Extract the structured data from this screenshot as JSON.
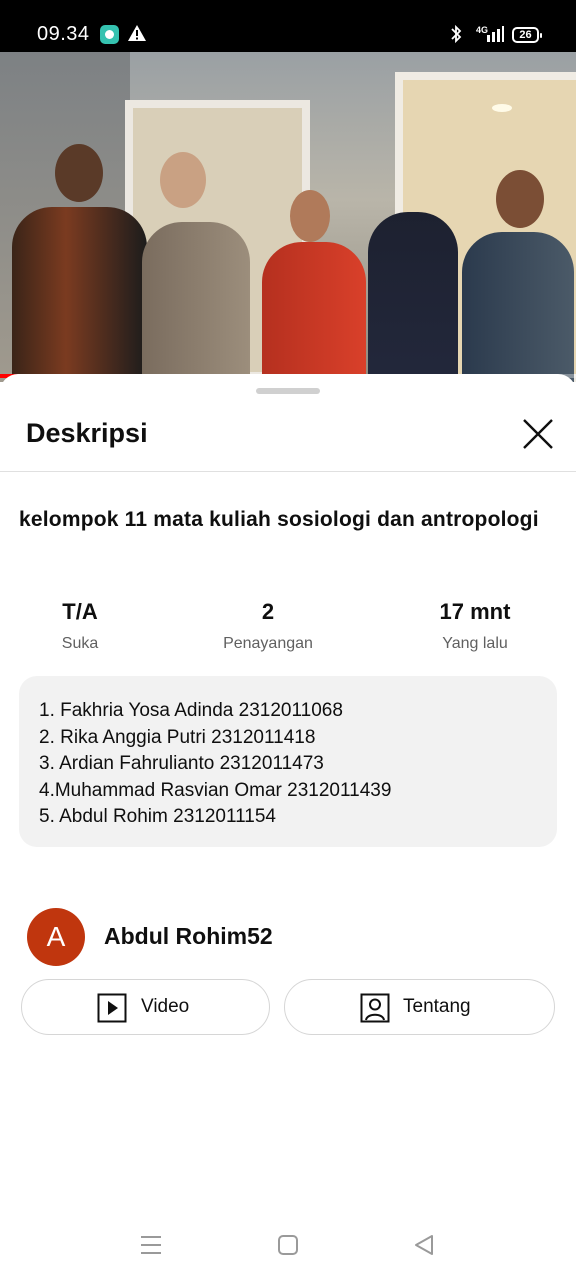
{
  "status_bar": {
    "time": "09.34",
    "network": "4G",
    "battery": "26"
  },
  "video": {
    "progress": 0.18,
    "progress_color": "#ff0000"
  },
  "sheet": {
    "title": "Deskripsi",
    "video_title": "kelompok 11 mata kuliah sosiologi dan antropologi",
    "stats": [
      {
        "value": "T/A",
        "label": "Suka"
      },
      {
        "value": "2",
        "label": "Penayangan"
      },
      {
        "value": "17 mnt",
        "label": "Yang lalu"
      }
    ],
    "description_lines": [
      "1. Fakhria Yosa Adinda 2312011068",
      "2. Rika Anggia Putri 2312011418",
      "3. Ardian Fahrulianto 2312011473",
      "4.Muhammad Rasvian Omar 2312011439",
      "5. Abdul Rohim 2312011154"
    ],
    "channel": {
      "avatar_letter": "A",
      "avatar_color": "#c0360e",
      "name": "Abdul Rohim52"
    },
    "buttons": {
      "videos": "Video",
      "about": "Tentang"
    }
  }
}
